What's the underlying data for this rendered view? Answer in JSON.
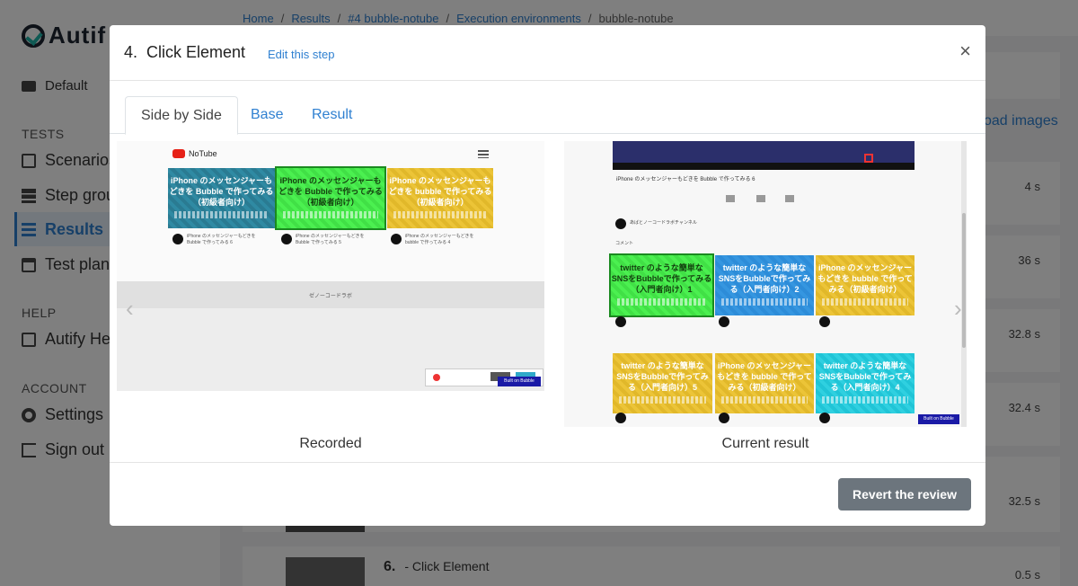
{
  "app": {
    "logo_text": "Autif",
    "workspace": "Default"
  },
  "sidebar": {
    "sections": [
      {
        "heading": "TESTS",
        "items": [
          {
            "label": "Scenarios",
            "icon": "document-icon"
          },
          {
            "label": "Step grou",
            "icon": "layers-icon"
          },
          {
            "label": "Results",
            "icon": "checklist-icon",
            "active": true
          },
          {
            "label": "Test plans",
            "icon": "calendar-icon"
          }
        ]
      },
      {
        "heading": "HELP",
        "items": [
          {
            "label": "Autify He",
            "icon": "document-icon"
          }
        ]
      },
      {
        "heading": "ACCOUNT",
        "items": [
          {
            "label": "Settings",
            "icon": "gear-icon"
          },
          {
            "label": "Sign out",
            "icon": "sign-out-icon"
          }
        ]
      }
    ]
  },
  "breadcrumb": {
    "items": [
      "Home",
      "Results",
      "#4 bubble-notube",
      "Execution environments"
    ],
    "current": "bubble-notube",
    "separator": "/"
  },
  "background": {
    "load_images": "oad images",
    "durations": [
      "4 s",
      "36 s",
      "32.8 s",
      "32.4 s",
      "32.5 s",
      "0.5 s"
    ],
    "step6_number": "6.",
    "step6_label": "- Click Element"
  },
  "modal": {
    "title": "4.  Click Element",
    "edit_link": "Edit this step",
    "close_label": "×",
    "tabs": [
      {
        "label": "Side by Side",
        "active": true
      },
      {
        "label": "Base",
        "active": false
      },
      {
        "label": "Result",
        "active": false
      }
    ],
    "recorded_label": "Recorded",
    "result_label": "Current result",
    "prev_arrow": "‹",
    "next_arrow": "›",
    "revert_button": "Revert the review"
  },
  "recorded_shot": {
    "brand": "NoTube",
    "cards": [
      {
        "title": "iPhone のメッセンジャーもどきを Bubble で作ってみる（初級者向け）",
        "color": "teal"
      },
      {
        "title": "iPhone のメッセンジャーもどきを Bubble で作ってみる（初級者向け）",
        "color": "green",
        "highlight": true
      },
      {
        "title": "iPhone のメッセンジャーもどきを bubble で作ってみる（初級者向け）",
        "color": "yellow"
      }
    ],
    "meta": [
      "iPhone のメッセンジャーもどきを Bubble で作ってみる 6",
      "iPhone のメッセンジャーもどきを Bubble で作ってみる 5",
      "iPhone のメッセンジャーもどきを bubble で作ってみる 4"
    ],
    "footer_text": "ゼノーコードラボ",
    "built_on": "Built on Bubble"
  },
  "result_shot": {
    "video_title": "iPhone のメッセンジャーもどきを Bubble で作ってみる 6",
    "channel": "あばとノーコードラボチャンネル",
    "comment_label": "コメント",
    "cards": [
      {
        "title": "twitter のような簡単な SNSをBubbleで作ってみる（入門者向け）1",
        "color": "green",
        "highlight": true
      },
      {
        "title": "twitter のような簡単な SNSをBubbleで作ってみる（入門者向け）2",
        "color": "blue"
      },
      {
        "title": "iPhone のメッセンジャーもどきを bubble で作ってみる（初級者向け）",
        "color": "yellow"
      },
      {
        "title": "twitter のような簡単な SNSをBubbleで作ってみる（入門者向け）5",
        "color": "yellow"
      },
      {
        "title": "iPhone のメッセンジャーもどきを bubble で作ってみる（初級者向け）",
        "color": "yellow"
      },
      {
        "title": "twitter のような簡単な SNSをBubbleで作ってみる（入門者向け）4",
        "color": "cyan"
      }
    ],
    "built_on": "Built on Bubble"
  }
}
